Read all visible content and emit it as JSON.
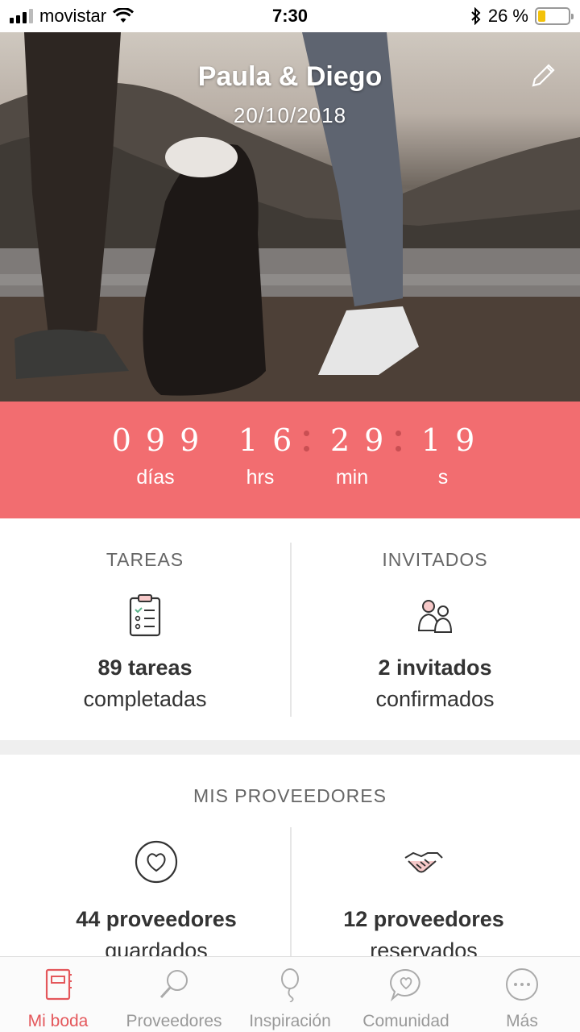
{
  "status_bar": {
    "carrier": "movistar",
    "time": "7:30",
    "battery_percent": "26 %",
    "battery_level": 0.26
  },
  "hero": {
    "title": "Paula & Diego",
    "date": "20/10/2018",
    "edit_icon": "pencil-icon"
  },
  "countdown": {
    "days": "099",
    "hours": "16",
    "minutes": "29",
    "seconds": "19",
    "days_label": "días",
    "hours_label": "hrs",
    "minutes_label": "min",
    "seconds_label": "s",
    "background": "#f26d70"
  },
  "stats": {
    "tasks": {
      "heading": "TAREAS",
      "count": "89 tareas",
      "sub": "completadas",
      "icon": "clipboard-checklist-icon"
    },
    "guests": {
      "heading": "INVITADOS",
      "count": "2 invitados",
      "sub": "confirmados",
      "icon": "couple-icon"
    }
  },
  "providers": {
    "heading": "MIS PROVEEDORES",
    "saved": {
      "count": "44 proveedores",
      "sub": "guardados",
      "icon": "heart-circle-icon"
    },
    "booked": {
      "count": "12 proveedores",
      "sub": "reservados",
      "icon": "handshake-icon"
    }
  },
  "tabbar": {
    "active": "Mi boda",
    "accent": "#e4575b",
    "items": [
      {
        "label": "Mi boda",
        "icon": "notebook-icon"
      },
      {
        "label": "Proveedores",
        "icon": "magnifier-icon"
      },
      {
        "label": "Inspiración",
        "icon": "balloon-icon"
      },
      {
        "label": "Comunidad",
        "icon": "chat-heart-icon"
      },
      {
        "label": "Más",
        "icon": "more-icon"
      }
    ]
  }
}
